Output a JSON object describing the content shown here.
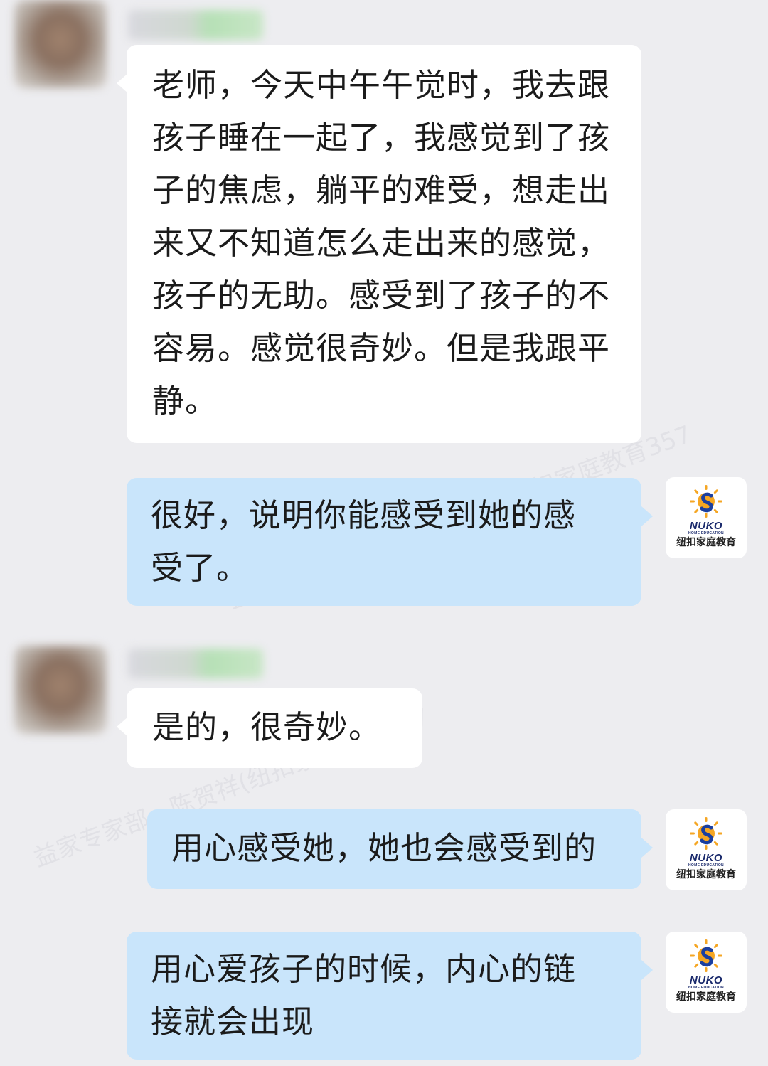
{
  "watermarks": [
    "益家专家部—陈贺祥(纽扣家庭教育357",
    "益家专家部—陈贺祥老师)@纽扣家庭教育357",
    "益家专家部—陈贺祥(纽扣家庭教育357"
  ],
  "messages": [
    {
      "side": "left",
      "text": "老师，今天中午午觉时，我去跟孩子睡在一起了，我感觉到了孩子的焦虑，躺平的难受，想走出来又不知道怎么走出来的感觉，孩子的无助。感受到了孩子的不容易。感觉很奇妙。但是我跟平静。"
    },
    {
      "side": "right",
      "text": "很好，说明你能感受到她的感受了。"
    },
    {
      "side": "left",
      "text": "是的，很奇妙。"
    },
    {
      "side": "right",
      "text": "用心感受她，她也会感受到的"
    },
    {
      "side": "right",
      "text": "用心爱孩子的时候，内心的链接就会出现"
    }
  ],
  "teacher_avatar": {
    "brand": "NUKO",
    "sub": "HOME EDUCATION",
    "name_cn": "纽扣家庭教育",
    "colors": {
      "sun": "#f5a623",
      "mark": "#1a3fa0"
    }
  },
  "colors": {
    "background": "#ededf0",
    "left_bubble": "#ffffff",
    "right_bubble": "#c9e5fb"
  }
}
